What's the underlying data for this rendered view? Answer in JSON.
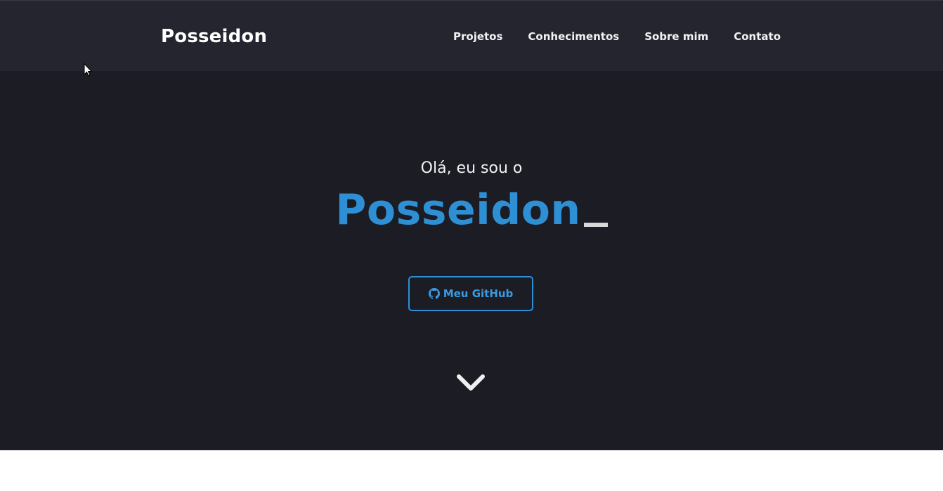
{
  "navbar": {
    "brand": "Posseidon",
    "links": [
      {
        "label": "Projetos"
      },
      {
        "label": "Conhecimentos"
      },
      {
        "label": "Sobre mim"
      },
      {
        "label": "Contato"
      }
    ]
  },
  "hero": {
    "greeting": "Olá, eu sou o",
    "title": "Posseidon",
    "github_button": {
      "label": "Meu GitHub",
      "icon": "github-icon"
    },
    "scroll_icon": "chevron-down-icon"
  },
  "colors": {
    "navbar_bg": "#24252e",
    "hero_bg": "#1b1c24",
    "accent": "#2e8fd4",
    "text": "#ffffff"
  }
}
